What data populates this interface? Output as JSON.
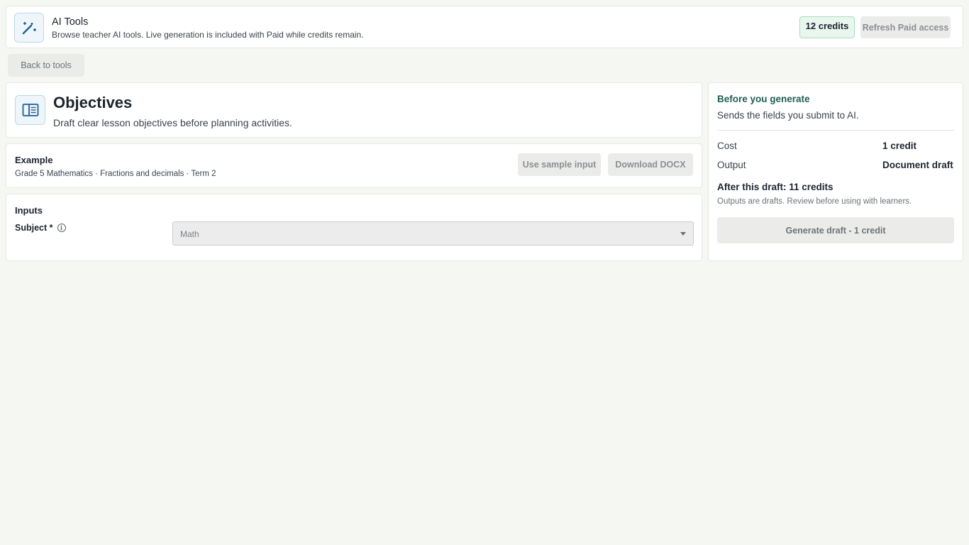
{
  "header": {
    "title": "AI Tools",
    "subtitle": "Browse teacher AI tools. Live generation is included with Paid while credits remain.",
    "icon": "magic-wand-icon",
    "credits": "12 credits",
    "refresh_label": "Refresh Paid access"
  },
  "nav": {
    "back_label": "Back to tools"
  },
  "tool": {
    "icon": "book-open-icon",
    "title": "Objectives",
    "description": "Draft clear lesson objectives before planning activities."
  },
  "example": {
    "title": "Example",
    "description": "Grade 5 Mathematics · Fractions and decimals · Term 2",
    "sample_label": "Use sample input",
    "download_label": "Download DOCX"
  },
  "inputs": {
    "title": "Inputs",
    "subject_label": "Subject *",
    "subject_value": "Math"
  },
  "summary": {
    "title": "Before you generate",
    "subtitle": "Sends the fields you submit to AI.",
    "cost_label": "Cost",
    "cost_value": "1 credit",
    "output_label": "Output",
    "output_value": "Document draft",
    "after_text": "After this draft: 11 credits",
    "note": "Outputs are drafts. Review before using with learners.",
    "generate_label": "Generate draft - 1 credit"
  },
  "colors": {
    "accent_teal": "#1f5f55",
    "badge_bg": "#e8f6ee",
    "icon_blue": "#1e5f95",
    "background": "#f5f7f3"
  }
}
